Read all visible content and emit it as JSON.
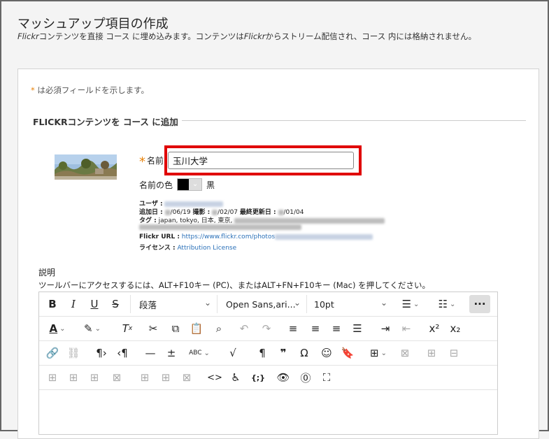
{
  "page": {
    "title": "マッシュアップ項目の作成",
    "subtitle_em1": "Flickr",
    "subtitle_part1": "コンテンツを直接 コース に埋め込みます。コンテンツは",
    "subtitle_em2": "Flickr",
    "subtitle_part2": "からストリーム配信され、コース 内には格納されません。"
  },
  "form": {
    "required_star": "*",
    "required_note": " は必須フィールドを示します。",
    "section_title": "FLICKRコンテンツを コース に追加",
    "name_label": "名前",
    "name_value": "玉川大学",
    "color_label": "名前の色",
    "color_name": "黒",
    "color_value": "#000000"
  },
  "meta": {
    "user_label": "ユーザ :",
    "added_label": "追加日 :",
    "added_value": "/06/19",
    "taken_label": "撮影 :",
    "taken_value": "/02/07",
    "updated_label": "最終更新日 :",
    "updated_value": "/01/04",
    "tags_label": "タグ :",
    "tags_value": "japan, tokyo, 日本, 東京,",
    "url_label": "Flickr URL :",
    "url_value": "https://www.flickr.com/photos",
    "license_label": "ライセンス :",
    "license_value": "Attribution License"
  },
  "description": {
    "label": "説明",
    "help": "ツールバーにアクセスするには、ALT+F10キー (PC)、またはALT+FN+F10キー (Mac) を押してください。"
  },
  "toolbar": {
    "paragraph": "段落",
    "font": "Open Sans,ari...",
    "size": "10pt"
  },
  "colors": {
    "required": "#e8830c",
    "highlight": "#e00000",
    "link": "#2a70b8"
  }
}
